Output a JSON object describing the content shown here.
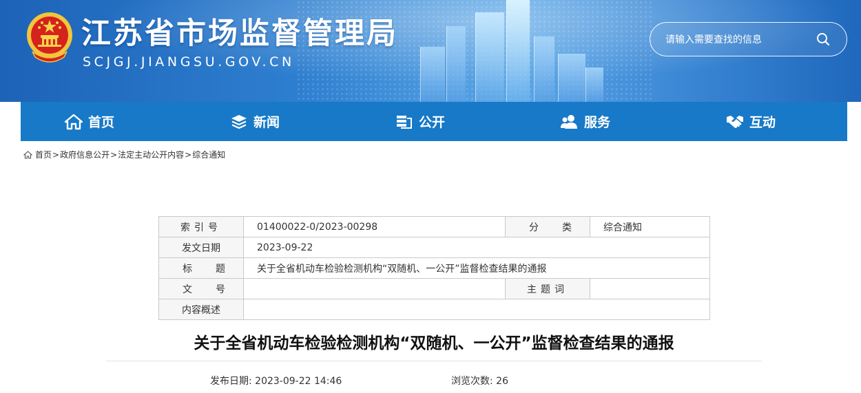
{
  "header": {
    "site_title": "江苏省市场监督管理局",
    "site_url": "SCJGJ.JIANGSU.GOV.CN",
    "search_placeholder": "请输入需要查找的信息",
    "search_value": ""
  },
  "nav": {
    "items": [
      {
        "label": "首页",
        "icon": "home-icon"
      },
      {
        "label": "新闻",
        "icon": "layers-icon"
      },
      {
        "label": "公开",
        "icon": "documents-icon"
      },
      {
        "label": "服务",
        "icon": "users-icon"
      },
      {
        "label": "互动",
        "icon": "handshake-icon"
      }
    ]
  },
  "breadcrumb": {
    "items": [
      "首页",
      "政府信息公开",
      "法定主动公开内容",
      "综合通知"
    ],
    "separator": ">"
  },
  "meta_table": {
    "index_label": "索引号",
    "index_value": "01400022-0/2023-00298",
    "category_label": "分类",
    "category_value": "综合通知",
    "date_label": "发文日期",
    "date_value": "2023-09-22",
    "title_label": "标题",
    "title_value": "关于全省机动车检验检测机构“双随机、一公开”监督检查结果的通报",
    "docnum_label": "文号",
    "docnum_value": "",
    "subject_label": "主题词",
    "subject_value": "",
    "summary_label": "内容概述",
    "summary_value": ""
  },
  "article": {
    "title": "关于全省机动车检验检测机构“双随机、一公开”监督检查结果的通报",
    "publish_label": "发布日期:",
    "publish_value": "2023-09-22 14:46",
    "views_label": "浏览次数:",
    "views_value": "26"
  },
  "colors": {
    "nav_bg": "#1779c7",
    "header_blue": "#2e7fd0"
  }
}
